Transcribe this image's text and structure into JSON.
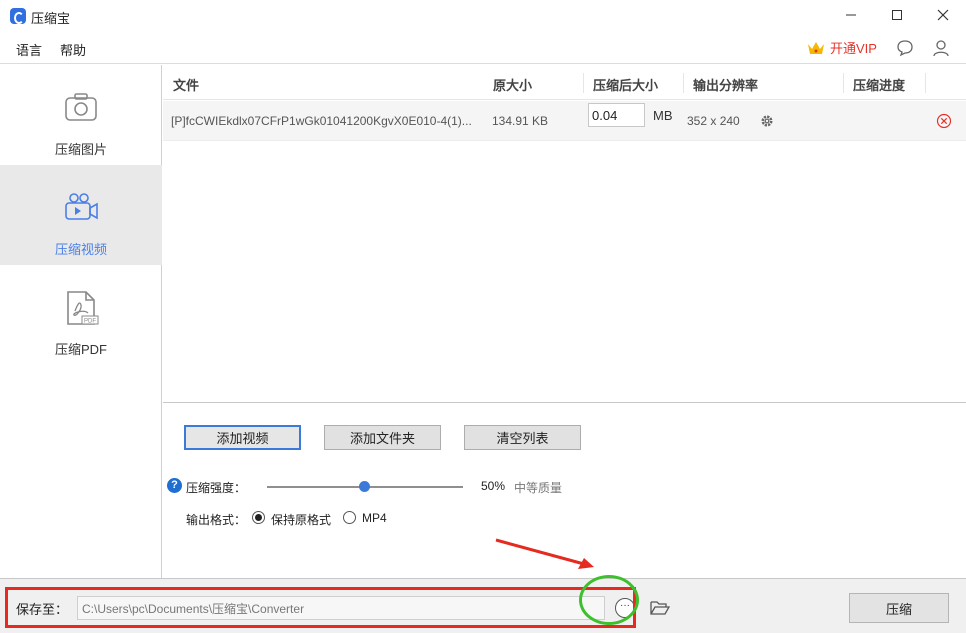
{
  "app": {
    "title": "压缩宝"
  },
  "menu": {
    "language": "语言",
    "help": "帮助",
    "vip_label": "开通VIP"
  },
  "sidebar": {
    "items": [
      {
        "label": "压缩图片",
        "icon": "camera-icon",
        "active": false
      },
      {
        "label": "压缩视频",
        "icon": "video-camera-icon",
        "active": true
      },
      {
        "label": "压缩PDF",
        "icon": "pdf-file-icon",
        "active": false
      }
    ]
  },
  "table": {
    "headers": [
      "文件",
      "原大小",
      "压缩后大小",
      "输出分辨率",
      "压缩进度"
    ],
    "rows": [
      {
        "file": "[P]fcCWIEkdlx07CFrP1wGk01041200KgvX0E010-4(1)...",
        "original_size": "134.91 KB",
        "target_size": "0.04",
        "unit": "MB",
        "resolution": "352 x 240",
        "progress": ""
      }
    ]
  },
  "actions": {
    "add_video": "添加视频",
    "add_folder": "添加文件夹",
    "clear_list": "清空列表"
  },
  "compression": {
    "strength_label": "压缩强度：",
    "strength_value": 50,
    "strength_percent": "50%",
    "quality_label": "中等质量"
  },
  "output_format": {
    "label": "输出格式：",
    "options": [
      "保持原格式",
      "MP4"
    ],
    "selected": "保持原格式"
  },
  "save": {
    "label": "保存至：",
    "path": "C:\\Users\\pc\\Documents\\压缩宝\\Converter",
    "more": "···",
    "compress_button": "压缩"
  },
  "colors": {
    "accent": "#3b7ad9",
    "vip": "#e5332a",
    "annotation_red": "#e52b20",
    "annotation_green": "#3ec02d",
    "active_sidebar_bg": "#e9e9e9"
  }
}
